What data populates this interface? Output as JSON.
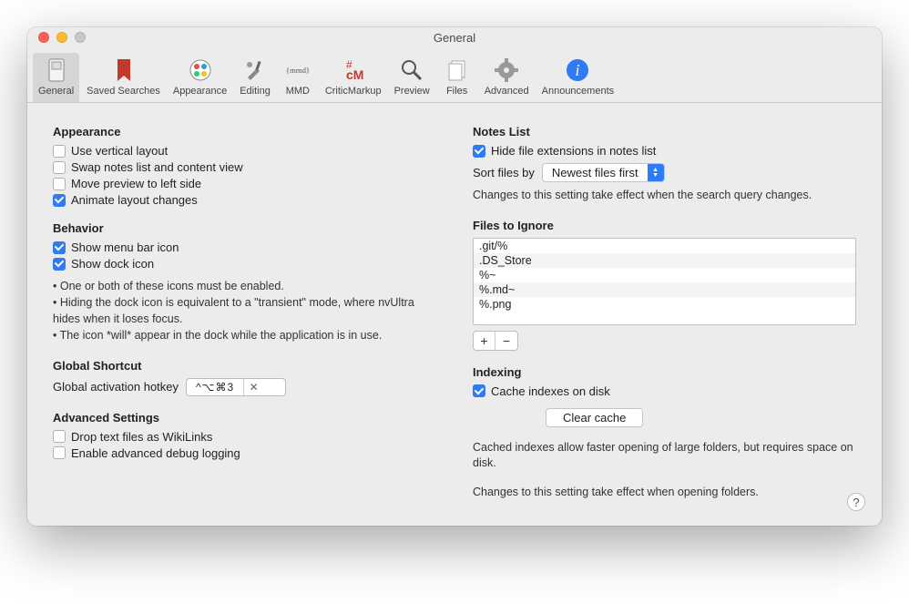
{
  "windowTitle": "General",
  "toolbar": [
    {
      "label": "General",
      "icon": "switch",
      "selected": true
    },
    {
      "label": "Saved Searches",
      "icon": "bookmark"
    },
    {
      "label": "Appearance",
      "icon": "palette"
    },
    {
      "label": "Editing",
      "icon": "tools"
    },
    {
      "label": "MMD",
      "icon": "mmd"
    },
    {
      "label": "CriticMarkup",
      "icon": "cm"
    },
    {
      "label": "Preview",
      "icon": "magnifier"
    },
    {
      "label": "Files",
      "icon": "files"
    },
    {
      "label": "Advanced",
      "icon": "gear"
    },
    {
      "label": "Announcements",
      "icon": "info"
    }
  ],
  "appearance": {
    "heading": "Appearance",
    "items": [
      {
        "label": "Use vertical layout",
        "checked": false
      },
      {
        "label": "Swap notes list and content view",
        "checked": false
      },
      {
        "label": "Move preview to left side",
        "checked": false
      },
      {
        "label": "Animate layout changes",
        "checked": true
      }
    ]
  },
  "behavior": {
    "heading": "Behavior",
    "items": [
      {
        "label": "Show menu bar icon",
        "checked": true
      },
      {
        "label": "Show dock icon",
        "checked": true
      }
    ],
    "notes": [
      "• One or both of these icons must be enabled.",
      "• Hiding the dock icon is equivalent to a \"transient\" mode, where nvUltra hides when it loses focus.",
      "• The icon *will* appear in the dock while the application is in use."
    ]
  },
  "globalShortcut": {
    "heading": "Global Shortcut",
    "label": "Global activation hotkey",
    "value": "^⌥⌘3"
  },
  "advancedSettings": {
    "heading": "Advanced Settings",
    "items": [
      {
        "label": "Drop text files as WikiLinks",
        "checked": false
      },
      {
        "label": "Enable advanced debug logging",
        "checked": false
      }
    ]
  },
  "notesList": {
    "heading": "Notes List",
    "hideExt": {
      "label": "Hide file extensions in notes list",
      "checked": true
    },
    "sortLabel": "Sort files by",
    "sortValue": "Newest files first",
    "sortNote": "Changes to this setting take effect when the search query changes."
  },
  "filesToIgnore": {
    "heading": "Files to Ignore",
    "items": [
      ".git/%",
      ".DS_Store",
      "%~",
      "%.md~",
      "%.png"
    ]
  },
  "indexing": {
    "heading": "Indexing",
    "cache": {
      "label": "Cache indexes on disk",
      "checked": true
    },
    "clearButton": "Clear cache",
    "desc1": "Cached indexes allow faster opening of large folders, but requires space on disk.",
    "desc2": "Changes to this setting take effect when opening folders."
  },
  "help": "?"
}
